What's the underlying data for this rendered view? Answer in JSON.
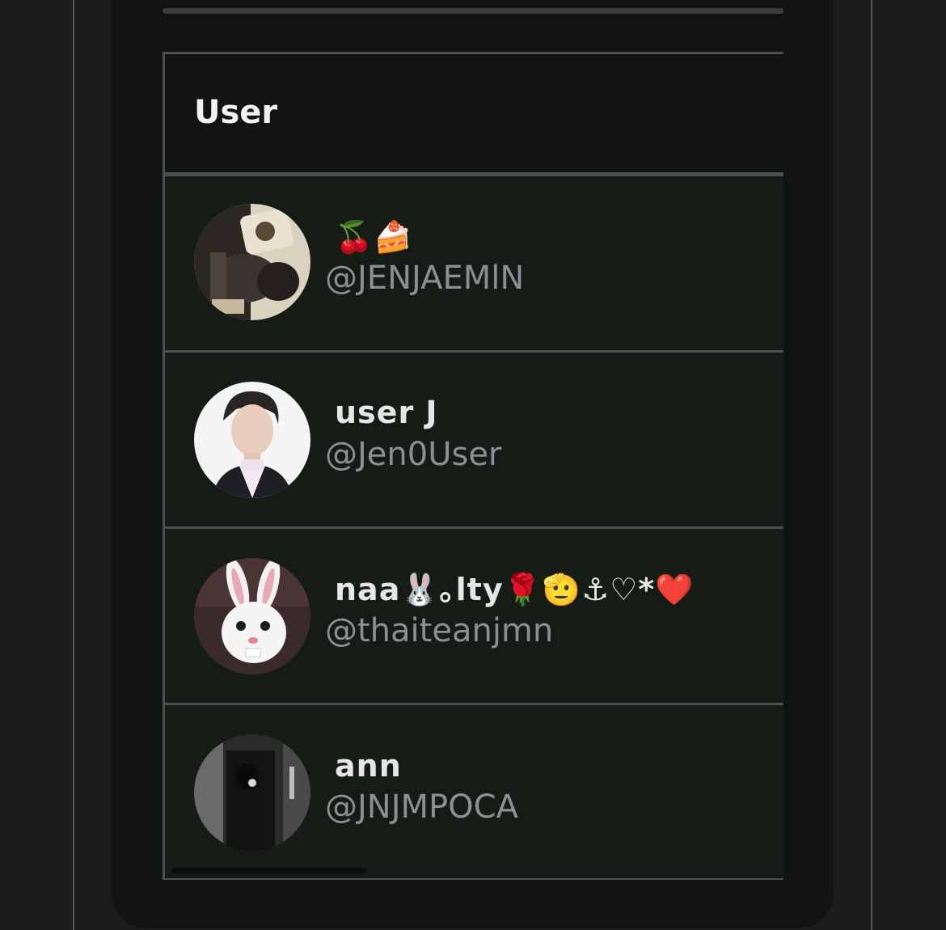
{
  "table": {
    "header": "User",
    "rows": [
      {
        "name": "🍒🍰",
        "handle": "@JENJAEMlN",
        "avatar": "user-photo-avatar"
      },
      {
        "name": "user J",
        "handle": "@Jen0User",
        "avatar": "user-photo-avatar"
      },
      {
        "name": "naa🐰｡lty🌹🫡⚓︎♡*❤️",
        "handle": "@thaiteanjmn",
        "avatar": "bunny-avatar"
      },
      {
        "name": "ann",
        "handle": "@JNJMPOCA",
        "avatar": "monochrome-photo-avatar"
      }
    ]
  },
  "colors": {
    "background": "#1b1c1e",
    "card": "#131314",
    "row": "#151b15",
    "border": "#4a4e55",
    "name": "#e6e6e6",
    "handle": "#8b8f96"
  }
}
